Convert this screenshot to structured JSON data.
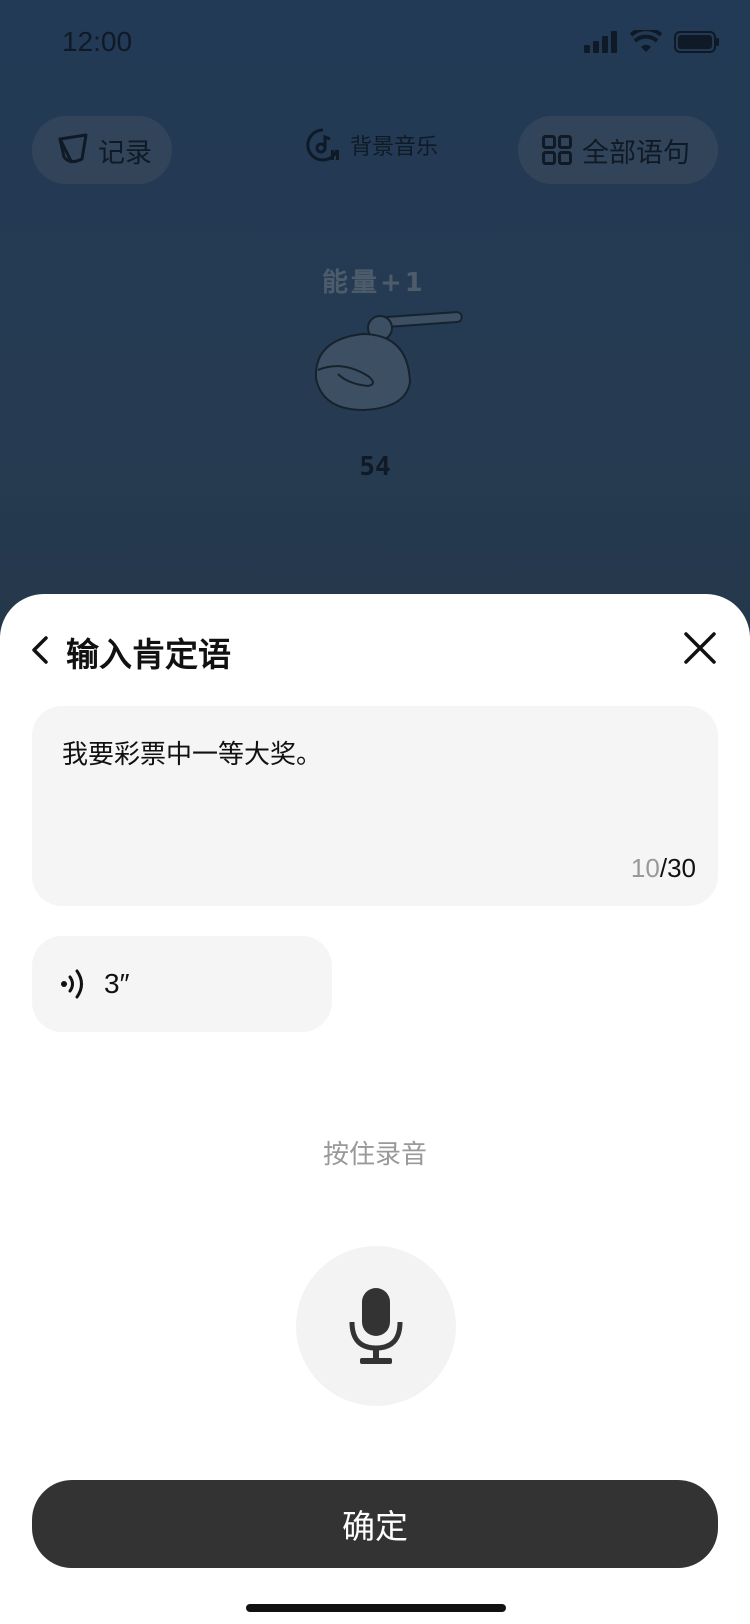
{
  "status_bar": {
    "time": "12:00"
  },
  "background_app": {
    "record_label": "记录",
    "music_label": "背景音乐",
    "all_sentences_label": "全部语句",
    "energy_label": "能量+1",
    "count": "54"
  },
  "sheet": {
    "title": "输入肯定语",
    "text_value": "我要彩票中一等大奖。",
    "char_count_current": "10",
    "char_count_sep_max": "/30",
    "voice_duration": "3″",
    "hold_hint": "按住录音",
    "confirm_label": "确定"
  },
  "icons": [
    "signal-icon",
    "wifi-icon",
    "battery-icon",
    "leaf-icon",
    "music-icon",
    "grid-icon",
    "back-chevron-icon",
    "close-icon",
    "sound-wave-icon",
    "microphone-icon"
  ],
  "colors": {
    "overlay_bg": "#24384f",
    "sheet_bg": "#ffffff",
    "field_bg": "#f5f5f5",
    "button_bg": "#333333"
  }
}
